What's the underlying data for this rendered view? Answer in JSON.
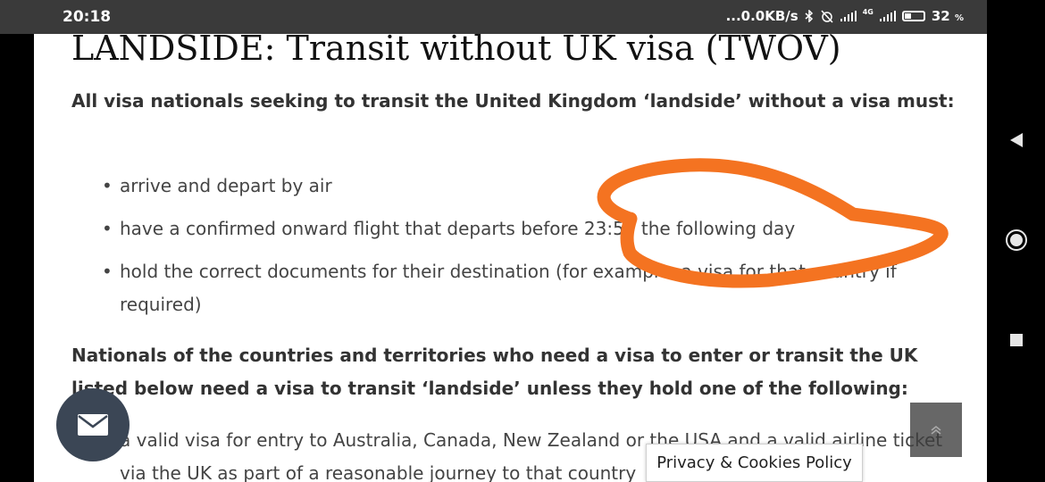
{
  "status_bar": {
    "time": "20:18",
    "network_speed": "...0.0KB/s",
    "network_type": "4G",
    "battery": "32",
    "battery_unit": "%"
  },
  "article": {
    "heading": "LANDSIDE: Transit without UK visa (TWOV)",
    "intro": "All visa nationals seeking to transit the United Kingdom ‘landside’ without a visa must:",
    "requirements": [
      "arrive and depart by air",
      "have a confirmed onward flight that departs before 23:59 the following day",
      "hold the correct documents for their destination (for example, a visa for that country if required)"
    ],
    "nationals_text": "Nationals of the countries and territories who need a visa to enter or transit the UK listed below need a visa to transit ‘landside’ unless they hold one of the following:",
    "exemptions": [
      "a valid visa for entry to Australia, Canada, New Zealand or the USA and a valid airline ticket via the UK as part of a reasonable journey to that country"
    ]
  },
  "privacy_label": "Privacy & Cookies Policy",
  "icons": {
    "mail": "mail-icon",
    "back_to_top": "chevron-up-icon",
    "nav_back": "triangle-back-icon",
    "nav_home": "circle-home-icon",
    "nav_recents": "square-recents-icon"
  },
  "colors": {
    "annotation": "#f47321",
    "mail_button": "#3b4655",
    "status_bar": "#3a3a3a"
  }
}
